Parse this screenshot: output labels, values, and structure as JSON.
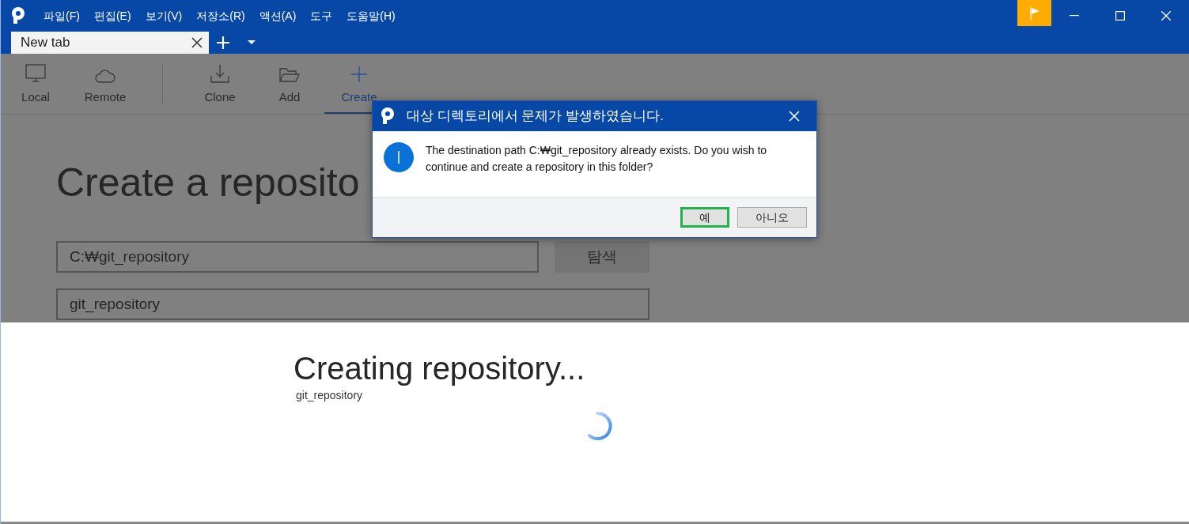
{
  "menu": [
    "파일(F)",
    "편집(E)",
    "보기(V)",
    "저장소(R)",
    "액션(A)",
    "도구",
    "도움말(H)"
  ],
  "tabs": [
    {
      "label": "New tab",
      "selected": true
    }
  ],
  "toolbar": [
    {
      "label": "Local",
      "kind": "monitor",
      "selected": false
    },
    {
      "label": "Remote",
      "kind": "cloud",
      "selected": false
    },
    {
      "label": "Clone",
      "kind": "download",
      "selected": false
    },
    {
      "label": "Add",
      "kind": "folder",
      "selected": false
    },
    {
      "label": "Create",
      "kind": "plus",
      "selected": true
    }
  ],
  "page": {
    "heading": "Create a reposito",
    "path": "C:₩git_repository",
    "browse": "탐색",
    "name": "git_repository"
  },
  "progress": {
    "title": "Creating repository...",
    "subtitle": "git_repository"
  },
  "dialog": {
    "title": "대상 디렉토리에서 문제가 발생하였습니다.",
    "message": "The destination path C:₩git_repository already exists. Do you wish to continue and create a repository in this folder?",
    "buttons": [
      {
        "label": "예",
        "focused": true
      },
      {
        "label": "아니오",
        "focused": false
      }
    ]
  }
}
